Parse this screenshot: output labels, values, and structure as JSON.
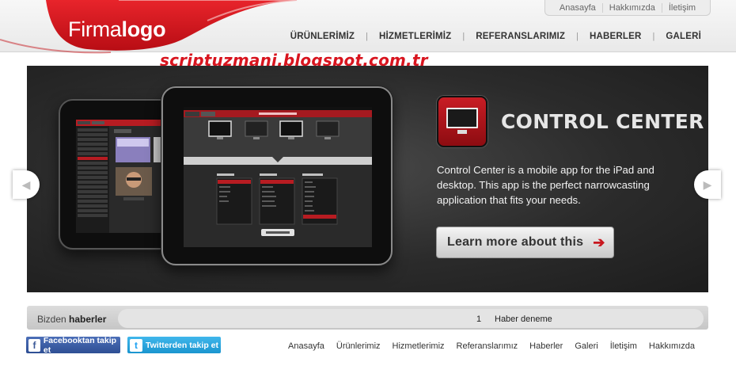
{
  "brand": {
    "logo_light": "Firma",
    "logo_bold": "logo",
    "accent_color": "#d8141e"
  },
  "top_links": [
    "Anasayfa",
    "Hakkımızda",
    "İletişim"
  ],
  "main_nav": [
    "ÜRÜNLERİMİZ",
    "HİZMETLERİMİZ",
    "REFERANSLARIMIZ",
    "HABERLER",
    "GALERİ"
  ],
  "nav_separator": "|",
  "watermark": "scriptuzmani.blogspot.com.tr",
  "slide": {
    "title": "CONTROL CENTER",
    "description": "Control Center is a mobile app for the iPad and desktop.  This app is the perfect narrowcasting application that fits your needs.",
    "button_label": "Learn more about this",
    "icon": "monitor-icon"
  },
  "slider_controls": {
    "prev_icon": "chevron-left-icon",
    "next_icon": "chevron-right-icon"
  },
  "news": {
    "heading_light": "Bizden ",
    "heading_bold": "haberler",
    "item_number": "1",
    "item_text": "Haber deneme"
  },
  "social": {
    "facebook_label": "Facebooktan takip et",
    "twitter_label": "Twitterden takip et"
  },
  "footer_nav": [
    "Anasayfa",
    "Ürünlerimiz",
    "Hizmetlerimiz",
    "Referanslarımız",
    "Haberler",
    "Galeri",
    "İletişim",
    "Hakkımızda"
  ]
}
